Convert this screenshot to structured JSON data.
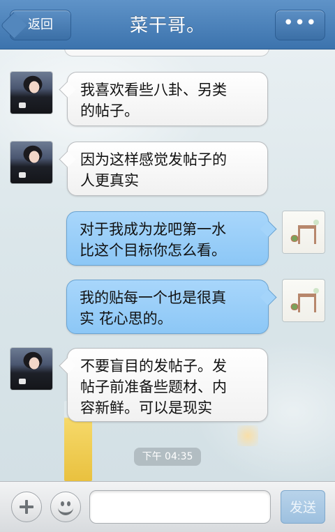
{
  "header": {
    "back_label": "返回",
    "title": "菜干哥。",
    "more_label": "•••"
  },
  "messages": [
    {
      "side": "left",
      "avatar": "girl-avatar",
      "lines": [
        "我喜欢看些八卦、另类",
        "的帖子。"
      ]
    },
    {
      "side": "left",
      "avatar": "girl-avatar",
      "lines": [
        "因为这样感觉发帖子的",
        "人更真实"
      ]
    },
    {
      "side": "right",
      "avatar": "room-avatar",
      "lines": [
        "对于我成为龙吧第一水",
        "比这个目标你怎么看。"
      ]
    },
    {
      "side": "right",
      "avatar": "room-avatar",
      "lines": [
        "我的贴每一个也是很真",
        "实 花心思的。"
      ]
    },
    {
      "side": "left",
      "avatar": "girl-avatar",
      "lines": [
        "不要盲目的发帖子。发",
        "帖子前准备些题材、内",
        "容新鲜。可以是现实"
      ]
    }
  ],
  "timestamp": "下午 04:35",
  "input_bar": {
    "input_value": "",
    "send_label": "发送"
  },
  "colors": {
    "header": "#4a80b9",
    "incoming_bubble": "#f5f5f5",
    "outgoing_bubble": "#9ccdf8",
    "send_button": "#a9c9e4"
  }
}
